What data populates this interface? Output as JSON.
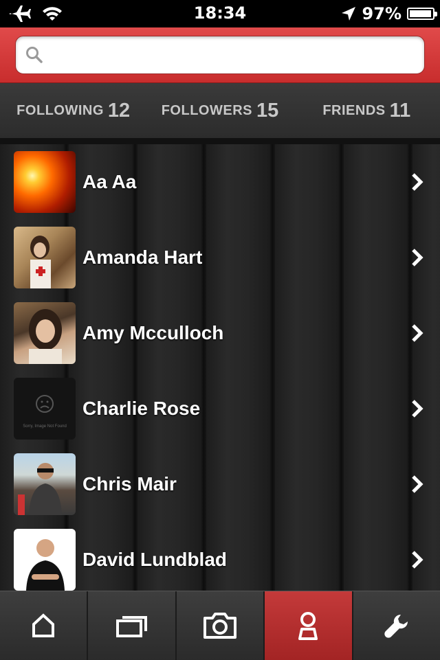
{
  "status_bar": {
    "time": "18:34",
    "battery_text": "97%",
    "battery_level": 0.97,
    "icons": [
      "airplane-icon",
      "wifi-icon",
      "location-icon",
      "battery-icon"
    ]
  },
  "search": {
    "placeholder": "",
    "value": ""
  },
  "tabs": [
    {
      "label": "FOLLOWING",
      "count": "12",
      "active": false
    },
    {
      "label": "FOLLOWERS",
      "count": "15",
      "active": true
    },
    {
      "label": "FRIENDS",
      "count": "11",
      "active": false
    }
  ],
  "people": [
    {
      "name": "Aa Aa"
    },
    {
      "name": "Amanda Hart"
    },
    {
      "name": "Amy Mcculloch"
    },
    {
      "name": "Charlie Rose",
      "avatar_caption": "Sorry, Image Not Found"
    },
    {
      "name": "Chris Mair"
    },
    {
      "name": "David Lundblad"
    }
  ],
  "tab_bar": {
    "items": [
      "home-icon",
      "gallery-icon",
      "camera-icon",
      "profile-icon",
      "wrench-icon"
    ],
    "active": "profile-icon"
  },
  "colors": {
    "accent_red": "#e21b1b",
    "header_red": "#d23a3a",
    "active_tab_bg": "#b52f2f"
  }
}
